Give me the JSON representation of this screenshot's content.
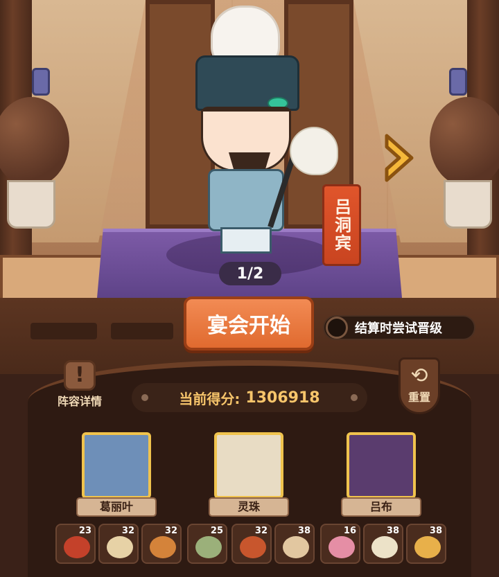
{
  "stage": {
    "character_name": "吕洞宾",
    "page_indicator": "1/2",
    "next_arrow_icon": "chevron-right-icon"
  },
  "actions": {
    "start_label": "宴会开始",
    "toggle_label": "结算时尝试晋级",
    "toggle_on": false,
    "lineup_label": "阵容详情",
    "reset_label": "重置"
  },
  "score": {
    "label": "当前得分:",
    "value": "1306918"
  },
  "heroes": [
    {
      "name": "葛丽叶",
      "color": "#6e8fb8"
    },
    {
      "name": "灵珠",
      "color": "#e8dcc4"
    },
    {
      "name": "吕布",
      "color": "#5a3c6e"
    }
  ],
  "dishes": [
    {
      "qty": "23",
      "color": "#c4412a"
    },
    {
      "qty": "32",
      "color": "#e7d2a6"
    },
    {
      "qty": "32",
      "color": "#d4833a"
    },
    {
      "qty": "25",
      "color": "#9bb07a"
    },
    {
      "qty": "32",
      "color": "#c8562d"
    },
    {
      "qty": "38",
      "color": "#e2c7a0"
    },
    {
      "qty": "16",
      "color": "#e58ea5"
    },
    {
      "qty": "38",
      "color": "#ece2c8"
    },
    {
      "qty": "38",
      "color": "#e8b04a"
    }
  ]
}
